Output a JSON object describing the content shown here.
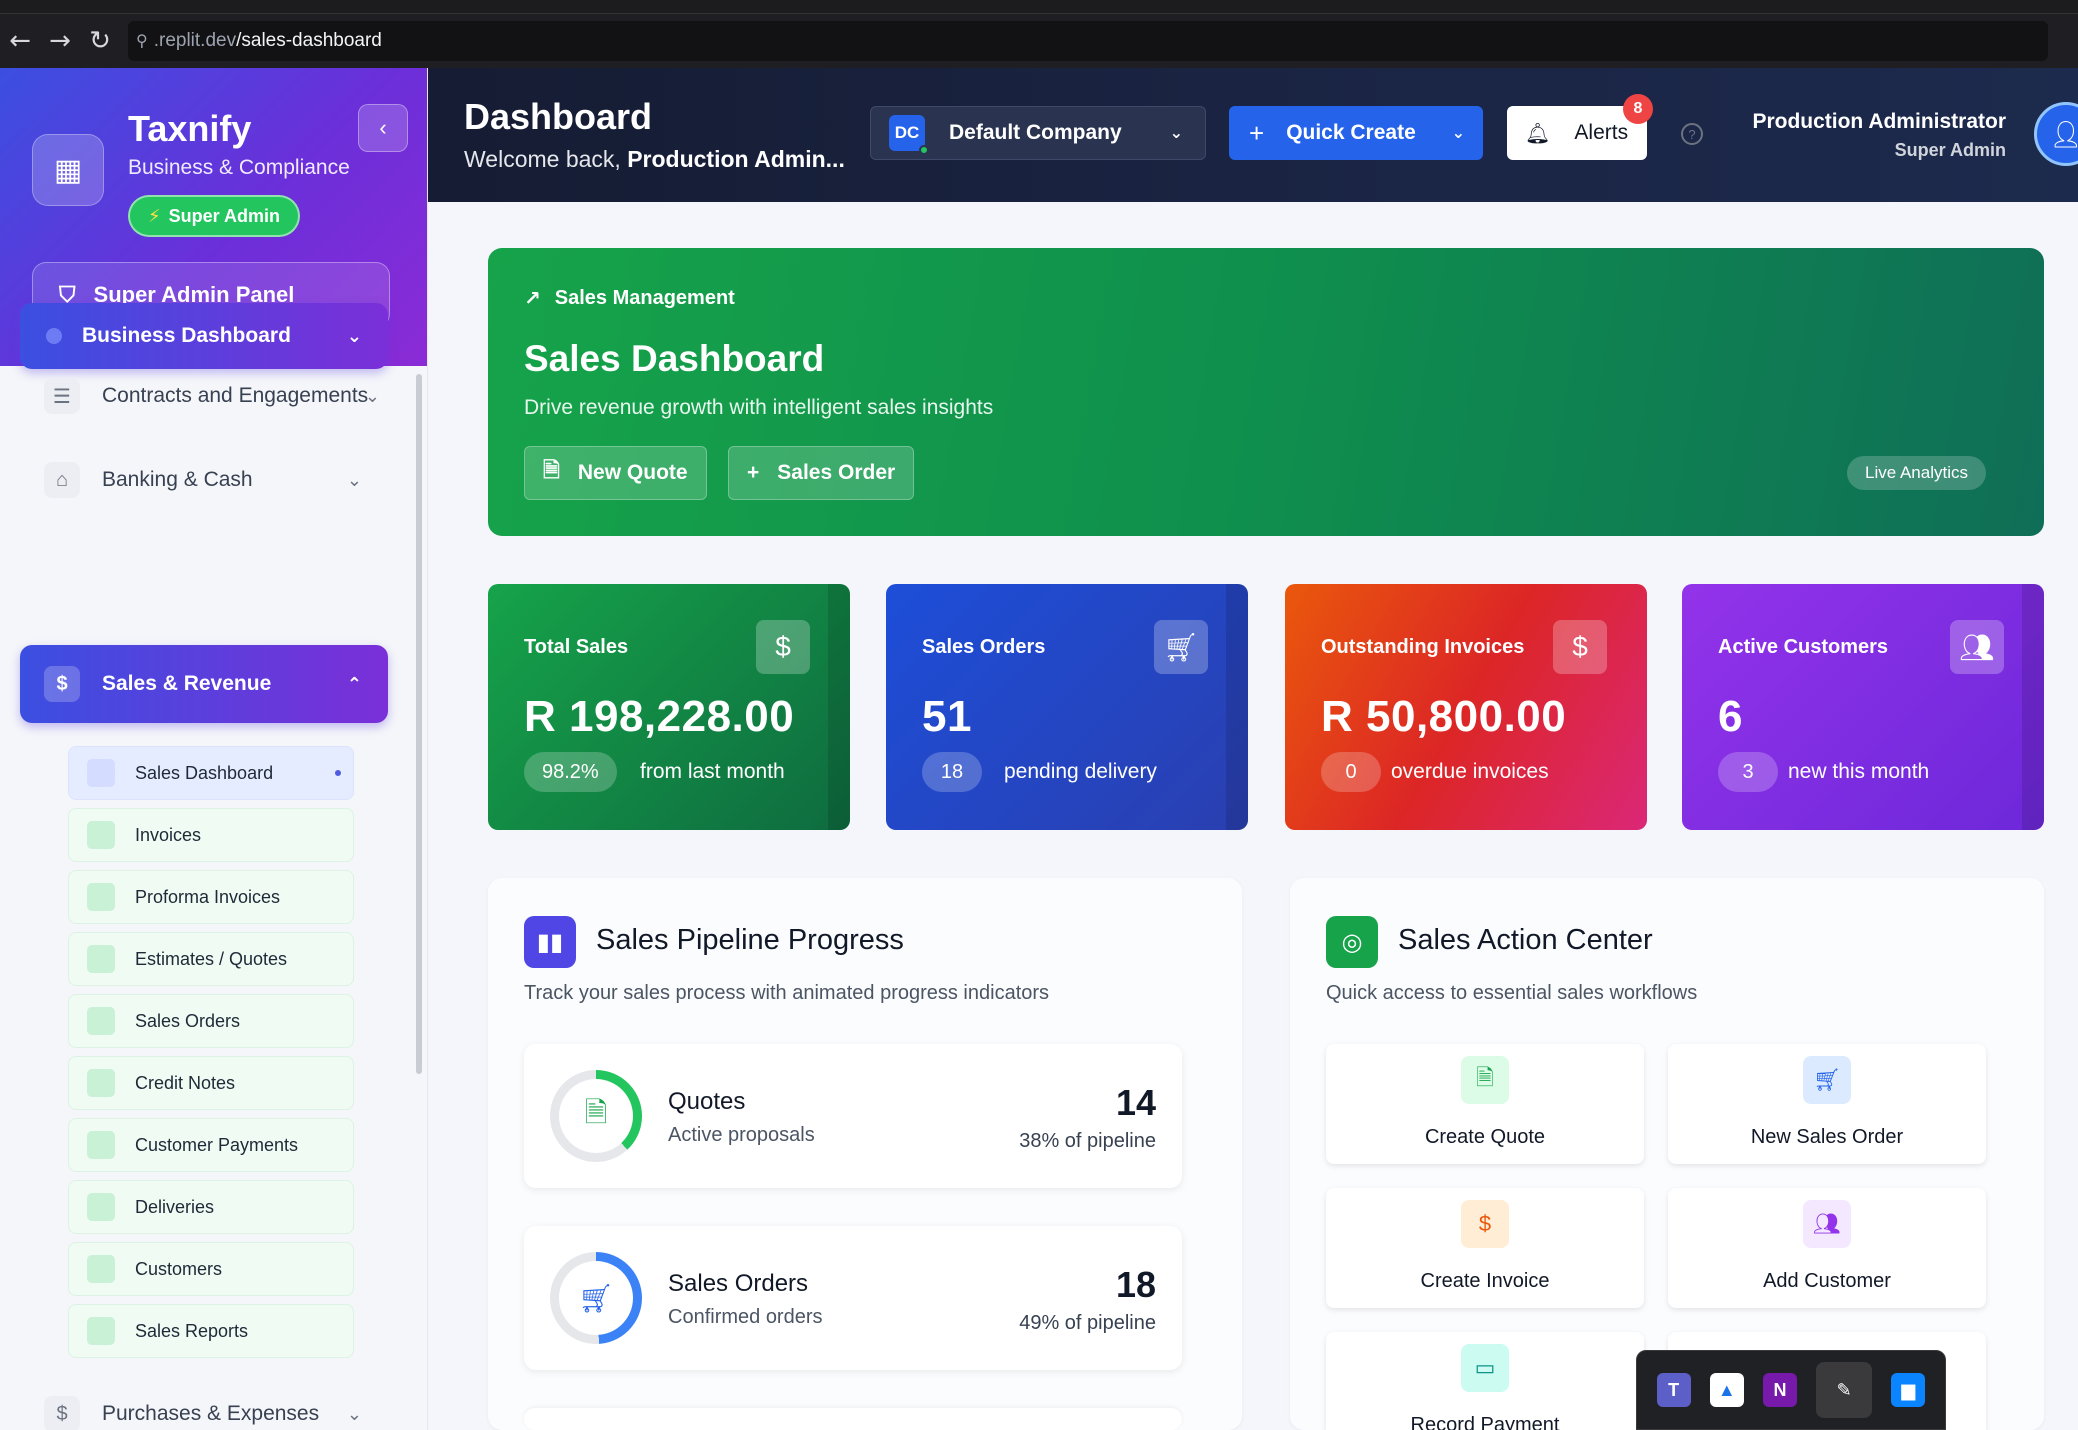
{
  "browser": {
    "url_host": ".replit.dev",
    "url_path": "/sales-dashboard"
  },
  "sidebar": {
    "brand_title": "Taxnify",
    "brand_subtitle": "Business & Compliance",
    "role_badge": "Super Admin",
    "panel_button": "Super Admin Panel",
    "nav": [
      {
        "label": "Business Dashboard"
      },
      {
        "label": "Contracts and Engagements"
      },
      {
        "label": "Banking & Cash"
      },
      {
        "label": "Sales & Revenue"
      },
      {
        "label": "Purchases & Expenses"
      }
    ],
    "sales_items": [
      "Sales Dashboard",
      "Invoices",
      "Proforma Invoices",
      "Estimates / Quotes",
      "Sales Orders",
      "Credit Notes",
      "Customer Payments",
      "Deliveries",
      "Customers",
      "Sales Reports"
    ]
  },
  "header": {
    "title": "Dashboard",
    "welcome_prefix": "Welcome back,",
    "welcome_name": "Production Admin...",
    "company_initials": "DC",
    "company_name": "Default Company",
    "quick_create": "Quick Create",
    "alerts_label": "Alerts",
    "alerts_count": "8",
    "user_name": "Production Administrator",
    "user_role": "Super Admin"
  },
  "hero": {
    "kicker": "Sales Management",
    "title": "Sales Dashboard",
    "description": "Drive revenue growth with intelligent sales insights",
    "btn_quote": "New Quote",
    "btn_order": "Sales Order",
    "live_badge": "Live Analytics"
  },
  "stats": [
    {
      "label": "Total Sales",
      "value": "R 198,228.00",
      "pill": "98.2%",
      "sub": "from last month",
      "color": "#15803d"
    },
    {
      "label": "Sales Orders",
      "value": "51",
      "pill": "18",
      "sub": "pending delivery",
      "color": "#1d4ed8"
    },
    {
      "label": "Outstanding Invoices",
      "value": "R 50,800.00",
      "pill": "0",
      "sub": "overdue invoices",
      "color": "#dc2626"
    },
    {
      "label": "Active Customers",
      "value": "6",
      "pill": "3",
      "sub": "new this month",
      "color": "#7e22ce"
    }
  ],
  "pipeline": {
    "title": "Sales Pipeline Progress",
    "description": "Track your sales process with animated progress indicators",
    "stages": [
      {
        "name": "Quotes",
        "desc": "Active proposals",
        "count": "14",
        "pct": "38% of pipeline",
        "progress": 0.38,
        "color": "#22c55e"
      },
      {
        "name": "Sales Orders",
        "desc": "Confirmed orders",
        "count": "18",
        "pct": "49% of pipeline",
        "progress": 0.49,
        "color": "#3b82f6"
      }
    ]
  },
  "actions": {
    "title": "Sales Action Center",
    "description": "Quick access to essential sales workflows",
    "items": [
      {
        "label": "Create Quote"
      },
      {
        "label": "New Sales Order"
      },
      {
        "label": "Create Invoice"
      },
      {
        "label": "Add Customer"
      },
      {
        "label": "Record Payment"
      }
    ]
  }
}
